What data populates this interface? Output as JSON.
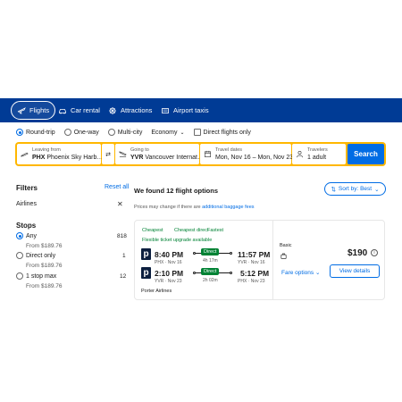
{
  "nav": {
    "items": [
      {
        "label": "Flights",
        "icon": "plane-icon",
        "active": true
      },
      {
        "label": "Car rental",
        "icon": "car-icon"
      },
      {
        "label": "Attractions",
        "icon": "attractions-icon"
      },
      {
        "label": "Airport taxis",
        "icon": "taxi-icon"
      }
    ]
  },
  "trip": {
    "round_trip": "Round-trip",
    "one_way": "One-way",
    "multi_city": "Multi-city",
    "cabin": "Economy",
    "direct_only": "Direct flights only"
  },
  "search": {
    "from_label": "Leaving from",
    "from_code": "PHX",
    "from_city": "Phoenix Sky Harb…",
    "to_label": "Going to",
    "to_code": "YVR",
    "to_city": "Vancouver Internat…",
    "dates_label": "Travel dates",
    "dates_value": "Mon, Nov 16 – Mon, Nov 23",
    "travelers_label": "Travelers",
    "travelers_value": "1 adult",
    "button": "Search"
  },
  "filters": {
    "title": "Filters",
    "reset": "Reset all",
    "airlines": "Airlines",
    "stops_title": "Stops",
    "stops": [
      {
        "label": "Any",
        "from": "From $189.76",
        "count": "818",
        "selected": true
      },
      {
        "label": "Direct only",
        "from": "From $189.76",
        "count": "1"
      },
      {
        "label": "1 stop max",
        "from": "From $189.76",
        "count": "12"
      }
    ]
  },
  "results": {
    "found": "We found 12 flight options",
    "sort": "Sort by: Best",
    "note_prefix": "Prices may change if there are",
    "note_link": "additional baggage fees"
  },
  "card": {
    "tags": [
      "Cheapest",
      "Cheapest direct",
      "Fastest"
    ],
    "flexible": "Flexible ticket upgrade available",
    "outbound": {
      "dep_time": "8:40 PM",
      "dep_sub": "PHX · Nov 16",
      "badge": "Direct",
      "duration": "4h 17m",
      "arr_time": "11:57 PM",
      "arr_sub": "YVR · Nov 16"
    },
    "inbound": {
      "dep_time": "2:10 PM",
      "dep_sub": "YVR · Nov 23",
      "badge": "Direct",
      "duration": "2h 02m",
      "arr_time": "5:12 PM",
      "arr_sub": "PHX · Nov 23"
    },
    "airline": "Porter Airlines",
    "logo_letter": "p",
    "fare_type": "Basic",
    "price": "$190",
    "fare_options": "Fare options",
    "view_details": "View details"
  },
  "colors": {
    "nav_bg": "#003b95",
    "accent": "#006ce4",
    "search_border": "#ffb700",
    "green": "#008234"
  }
}
